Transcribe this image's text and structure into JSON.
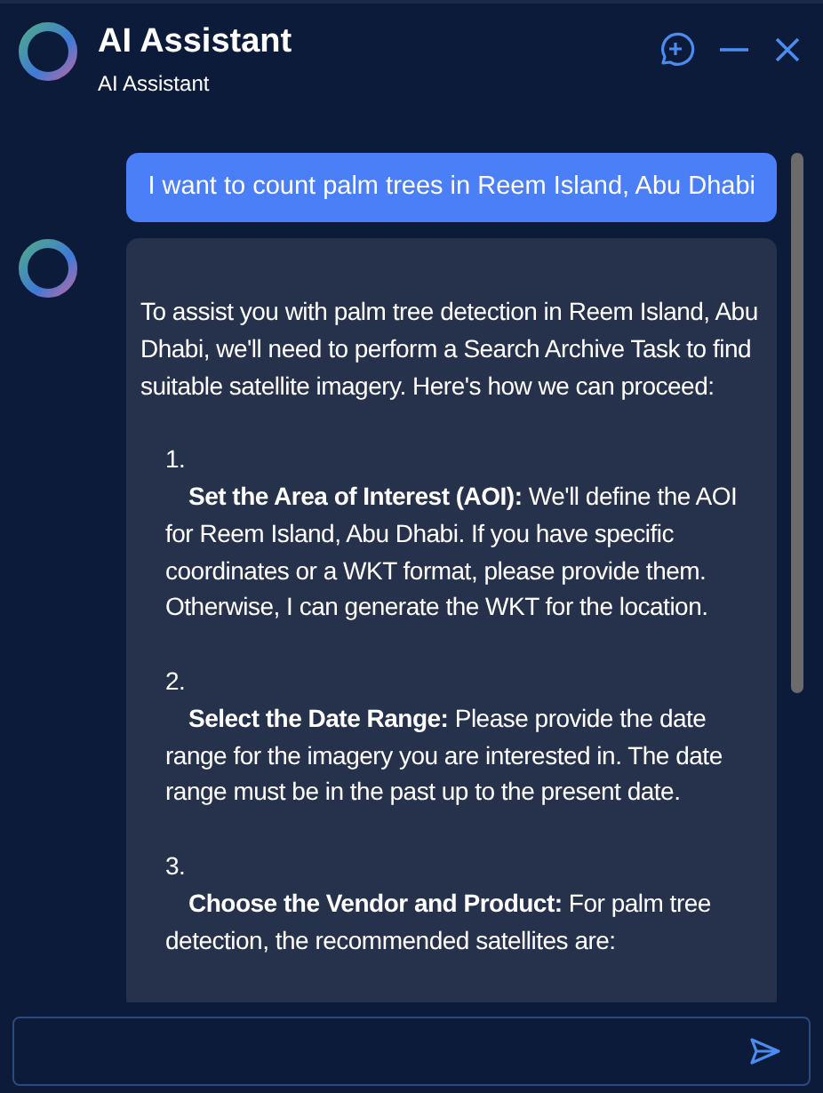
{
  "header": {
    "title": "AI Assistant",
    "subtitle": "AI Assistant"
  },
  "messages": [
    {
      "kind": "user",
      "text": "I want to count palm trees in Reem Island, Abu Dhabi"
    },
    {
      "kind": "assistant",
      "intro": "To assist you with palm tree detection in Reem Island, Abu Dhabi, we'll need to perform a Search Archive Task to find suitable satellite imagery. Here's how we can proceed:",
      "steps": [
        {
          "number": "1.",
          "text": "**Set the Area of Interest (AOI):** We'll define the AOI for Reem Island, Abu Dhabi. If you have specific coordinates or a WKT format, please provide them. Otherwise, I can generate the WKT for the location."
        },
        {
          "number": "2.",
          "text": "**Select the Date Range:** Please provide the date range for the imagery you are interested in. The date range must be in the past up to the present date."
        },
        {
          "number": "3.",
          "text": "**Choose the Vendor and Product:** For palm tree detection, the recommended satellites are:"
        }
      ]
    }
  ]
}
